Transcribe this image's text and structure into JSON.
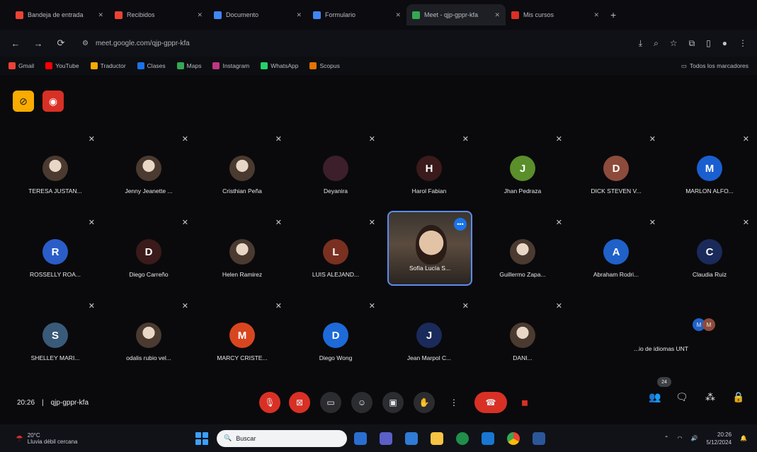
{
  "browser": {
    "tabs": [
      {
        "title": "Bandeja de entrada",
        "color": "#ea4335"
      },
      {
        "title": "Recibidos",
        "color": "#ea4335"
      },
      {
        "title": "Documento",
        "color": "#4285f4"
      },
      {
        "title": "Formulario",
        "color": "#4285f4"
      },
      {
        "title": "Meet - qjp-gppr-kfa",
        "color": "#34a853",
        "active": true
      },
      {
        "title": "Mis cursos",
        "color": "#d93025"
      }
    ],
    "url": "meet.google.com/qjp-gppr-kfa",
    "bookmarks": [
      {
        "label": "Gmail",
        "color": "#ea4335"
      },
      {
        "label": "YouTube",
        "color": "#ff0000"
      },
      {
        "label": "Traductor",
        "color": "#f9ab00"
      },
      {
        "label": "Clases",
        "color": "#1a73e8"
      },
      {
        "label": "Maps",
        "color": "#34a853"
      },
      {
        "label": "Instagram",
        "color": "#c13584"
      },
      {
        "label": "WhatsApp",
        "color": "#25d366"
      },
      {
        "label": "Scopus",
        "color": "#e37400"
      }
    ],
    "bookmarks_right": "Todos los marcadores"
  },
  "participants": [
    {
      "name": "TERESA JUSTAN...",
      "initial": "",
      "color": "",
      "photo": true
    },
    {
      "name": "Jenny Jeanette ...",
      "initial": "",
      "color": "",
      "photo": true
    },
    {
      "name": "Cristhian Peña",
      "initial": "",
      "color": "",
      "photo": true
    },
    {
      "name": "Deyanira",
      "initial": "",
      "color": "#3c1f2a",
      "photo": false
    },
    {
      "name": "Harol Fabian",
      "initial": "H",
      "color": "#3a1a1a",
      "photo": false
    },
    {
      "name": "Jhan Pedraza",
      "initial": "J",
      "color": "#5a8f2b",
      "photo": false
    },
    {
      "name": "DICK STEVEN V...",
      "initial": "D",
      "color": "#8d4b3b",
      "photo": false
    },
    {
      "name": "MARLON ALFO...",
      "initial": "M",
      "color": "#1a5fd0",
      "photo": false
    },
    {
      "name": "ROSSELLY ROA...",
      "initial": "R",
      "color": "#2b5dc8",
      "photo": false
    },
    {
      "name": "Diego Carreño",
      "initial": "D",
      "color": "#3a1a1a",
      "photo": false
    },
    {
      "name": "Helen Ramirez",
      "initial": "",
      "color": "#2560c0",
      "photo": true
    },
    {
      "name": "LUIS ALEJAND...",
      "initial": "L",
      "color": "#7a3020",
      "photo": false
    },
    {
      "name": "Guillermo Zapa...",
      "initial": "",
      "color": "#222",
      "photo": true
    },
    {
      "name": "Abraham Rodri...",
      "initial": "A",
      "color": "#1f61c9",
      "photo": false
    },
    {
      "name": "Claudia Ruiz",
      "initial": "C",
      "color": "#1a2a5a",
      "photo": false
    },
    {
      "name": "SHELLEY MARI...",
      "initial": "S",
      "color": "#3a5a7a",
      "photo": false
    },
    {
      "name": "odalis rubio vel...",
      "initial": "",
      "color": "#6a4a3a",
      "photo": true
    },
    {
      "name": "MARCY CRISTE...",
      "initial": "M",
      "color": "#d8461f",
      "photo": false
    },
    {
      "name": "Diego Wong",
      "initial": "D",
      "color": "#1d6ad8",
      "photo": false
    },
    {
      "name": "Jean Marpol C...",
      "initial": "J",
      "color": "#1a2a5a",
      "photo": false
    },
    {
      "name": "DANI...",
      "initial": "",
      "color": "#2a2a3a",
      "photo": true
    }
  ],
  "self": {
    "name": "Sofía Lucía S..."
  },
  "overlay_text": "...io de idiomas UNT",
  "meeting": {
    "time": "20:26",
    "code": "qjp-gppr-kfa"
  },
  "taskbar": {
    "weather": "Lluvia débil cercana",
    "temp": "20°C",
    "search": "Buscar",
    "clock": "20:26",
    "date": "5/12/2024"
  }
}
